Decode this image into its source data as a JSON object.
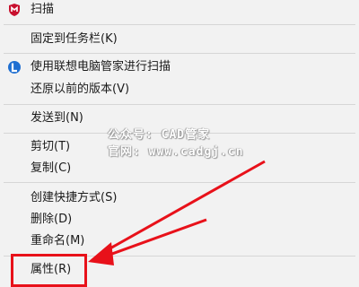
{
  "menu": {
    "scan": "扫描",
    "pin_taskbar": "固定到任务栏(K)",
    "lenovo_scan": "使用联想电脑管家进行扫描",
    "restore_version": "还原以前的版本(V)",
    "send_to": "发送到(N)",
    "cut": "剪切(T)",
    "copy": "复制(C)",
    "create_shortcut": "创建快捷方式(S)",
    "delete": "删除(D)",
    "rename": "重命名(M)",
    "properties": "属性(R)"
  },
  "watermark": {
    "line1": "公众号: CAD管家",
    "line2": "官网: www.cadgj.cn"
  },
  "icons": {
    "scan": "mcafee-shield-icon",
    "lenovo_scan": "lenovo-pc-manager-icon"
  },
  "colors": {
    "menu_bg": "#f2f2f2",
    "separator": "#d6d6d6",
    "highlight": "#e8111a",
    "mcafee": "#c8102e",
    "lenovo": "#1f6fd1"
  }
}
